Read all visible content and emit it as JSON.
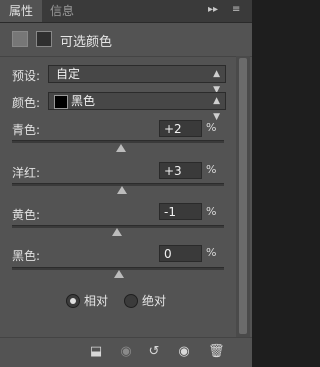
{
  "tabs": [
    {
      "label": "属性"
    },
    {
      "label": "信息"
    }
  ],
  "header": {
    "title": "可选颜色"
  },
  "preset": {
    "label": "预设:",
    "value": "自定"
  },
  "colors": {
    "label": "颜色:",
    "value": "黑色",
    "swatch": "#000000"
  },
  "sliders": [
    {
      "label": "青色:",
      "value": "+2",
      "unit": "%"
    },
    {
      "label": "洋红:",
      "value": "+3",
      "unit": "%"
    },
    {
      "label": "黄色:",
      "value": "-1",
      "unit": "%"
    },
    {
      "label": "黑色:",
      "value": "0",
      "unit": "%"
    }
  ],
  "method": {
    "options": [
      {
        "label": "相对",
        "selected": true
      },
      {
        "label": "绝对",
        "selected": false
      }
    ]
  }
}
